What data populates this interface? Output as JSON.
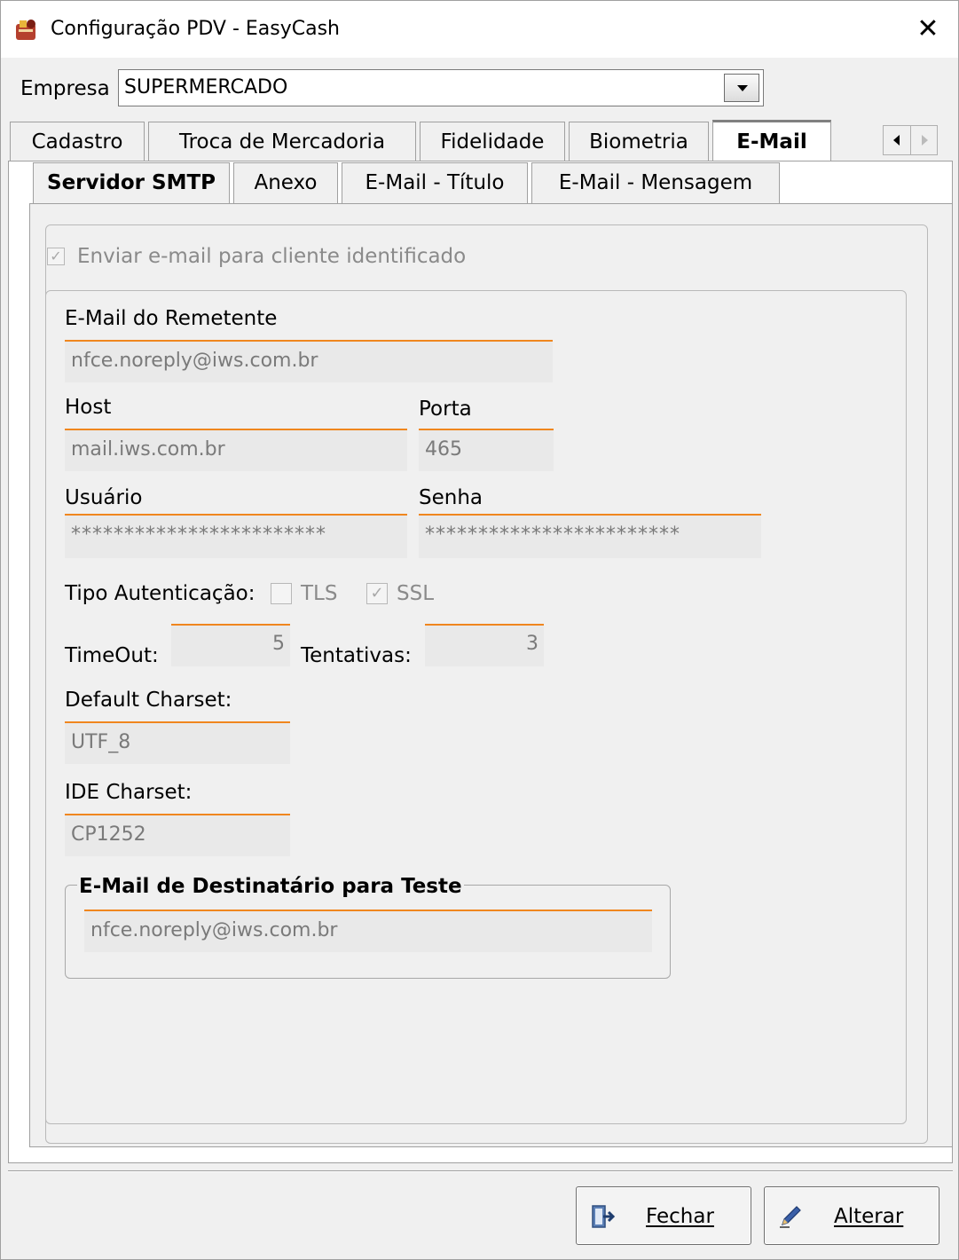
{
  "window": {
    "title": "Configuração PDV - EasyCash"
  },
  "empresa": {
    "label": "Empresa",
    "value": "SUPERMERCADO"
  },
  "tabs": [
    {
      "label": "Cadastro"
    },
    {
      "label": "Troca de Mercadoria"
    },
    {
      "label": "Fidelidade"
    },
    {
      "label": "Biometria"
    },
    {
      "label": "E-Mail",
      "active": true
    }
  ],
  "subtabs": [
    {
      "label": "Servidor SMTP",
      "active": true
    },
    {
      "label": "Anexo"
    },
    {
      "label": "E-Mail - Título"
    },
    {
      "label": "E-Mail - Mensagem"
    }
  ],
  "smtp": {
    "send_checkbox": {
      "label": "Enviar e-mail para cliente identificado",
      "checked": true,
      "enabled": false
    },
    "sender": {
      "label": "E-Mail do Remetente",
      "value": "nfce.noreply@iws.com.br"
    },
    "host": {
      "label": "Host",
      "value": "mail.iws.com.br"
    },
    "port": {
      "label": "Porta",
      "value": "465"
    },
    "user": {
      "label": "Usuário",
      "value": "************************"
    },
    "password": {
      "label": "Senha",
      "value": "************************"
    },
    "auth": {
      "label": "Tipo Autenticação:",
      "tls": {
        "label": "TLS",
        "checked": false
      },
      "ssl": {
        "label": "SSL",
        "checked": true
      }
    },
    "timeout": {
      "label": "TimeOut:",
      "value": "5"
    },
    "retries": {
      "label": "Tentativas:",
      "value": "3"
    },
    "default_charset": {
      "label": "Default Charset:",
      "value": "UTF_8"
    },
    "ide_charset": {
      "label": "IDE Charset:",
      "value": "CP1252"
    },
    "test_recipient": {
      "title": "E-Mail de Destinatário para Teste",
      "value": "nfce.noreply@iws.com.br"
    }
  },
  "buttons": {
    "close": {
      "label": "Fechar",
      "icon": "exit-door-icon"
    },
    "edit": {
      "label": "Alterar",
      "icon": "pencil-icon"
    }
  },
  "colors": {
    "field_accent": "#f0861e",
    "field_bg": "#e9e9e9",
    "disabled_text": "#8a8a8a"
  }
}
